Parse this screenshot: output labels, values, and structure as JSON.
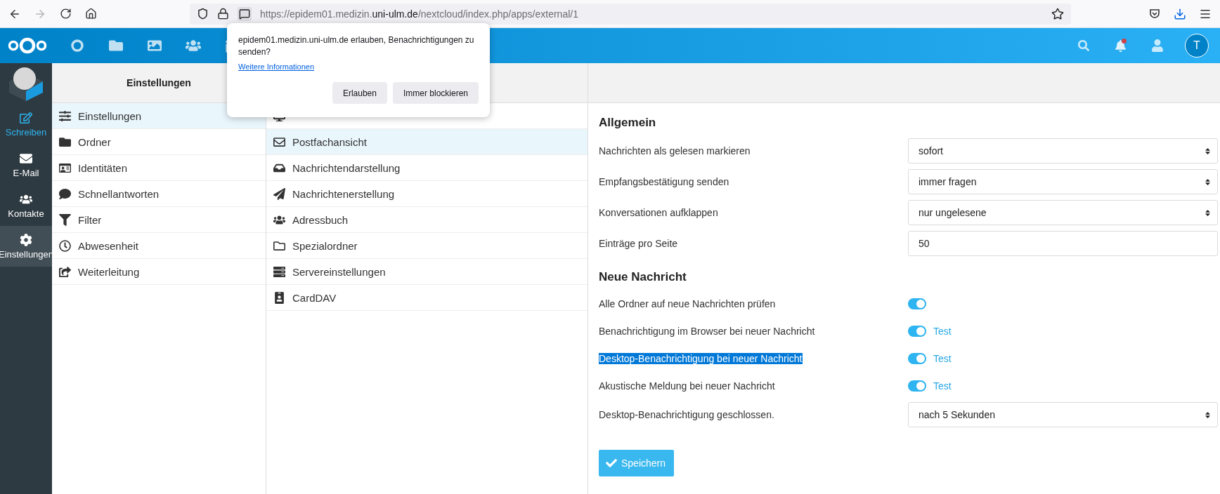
{
  "browser": {
    "url_prefix": "https://epidem01.medizin.",
    "url_domain": "uni-ulm.de",
    "url_path": "/nextcloud/index.php/apps/external/1",
    "forward_disabled": true
  },
  "header": {
    "avatar": "T",
    "notifications_unread": true
  },
  "permission_popup": {
    "message": "epidem01.medizin.uni-ulm.de erlauben, Benachrichtigungen zu senden?",
    "link": "Weitere Informationen",
    "buttons": [
      "Erlauben",
      "Immer blockieren"
    ]
  },
  "sidebar": {
    "items": [
      {
        "label": "Schreiben",
        "kind": "action",
        "selected": false
      },
      {
        "label": "E-Mail",
        "kind": "nav",
        "selected": false
      },
      {
        "label": "Kontakte",
        "kind": "nav",
        "selected": false
      },
      {
        "label": "Einstellungen",
        "kind": "nav",
        "selected": true
      }
    ]
  },
  "settings_menu": {
    "title": "Einstellungen",
    "items": [
      {
        "label": "Einstellungen",
        "selected": true
      },
      {
        "label": "Ordner",
        "selected": false
      },
      {
        "label": "Identitäten",
        "selected": false
      },
      {
        "label": "Schnellantworten",
        "selected": false
      },
      {
        "label": "Filter",
        "selected": false
      },
      {
        "label": "Abwesenheit",
        "selected": false
      },
      {
        "label": "Weiterleitung",
        "selected": false
      }
    ]
  },
  "submenu": {
    "items": [
      {
        "selected": false
      },
      {
        "label": "Postfachansicht",
        "selected": true
      },
      {
        "label": "Nachrichtendarstellung",
        "selected": false
      },
      {
        "label": "Nachrichtenerstellung",
        "selected": false
      },
      {
        "label": "Adressbuch",
        "selected": false
      },
      {
        "label": "Spezialordner",
        "selected": false
      },
      {
        "label": "Servereinstellungen",
        "selected": false
      },
      {
        "label": "CardDAV",
        "selected": false
      }
    ]
  },
  "panel": {
    "sections": [
      {
        "title": "Allgemein",
        "rows": [
          {
            "kind": "select",
            "label": "Nachrichten als gelesen markieren",
            "value": "sofort"
          },
          {
            "kind": "select",
            "label": "Empfangsbestätigung senden",
            "value": "immer fragen"
          },
          {
            "kind": "select",
            "label": "Konversationen aufklappen",
            "value": "nur ungelesene"
          },
          {
            "kind": "input",
            "label": "Einträge pro Seite",
            "value": "50"
          }
        ]
      },
      {
        "title": "Neue Nachricht",
        "rows": [
          {
            "kind": "toggle",
            "label": "Alle Ordner auf neue Nachrichten prüfen",
            "on": true,
            "highlighted": false
          },
          {
            "kind": "toggle",
            "label": "Benachrichtigung im Browser bei neuer Nachricht",
            "on": true,
            "highlighted": false,
            "test": "Test"
          },
          {
            "kind": "toggle",
            "label": "Desktop-Benachrichtigung bei neuer Nachricht",
            "on": true,
            "highlighted": true,
            "test": "Test"
          },
          {
            "kind": "toggle",
            "label": "Akustische Meldung bei neuer Nachricht",
            "on": true,
            "highlighted": false,
            "test": "Test"
          },
          {
            "kind": "select",
            "label": "Desktop-Benachrichtigung geschlossen.",
            "value": "nach 5 Sekunden"
          }
        ]
      }
    ],
    "save_button": "Speichern"
  }
}
